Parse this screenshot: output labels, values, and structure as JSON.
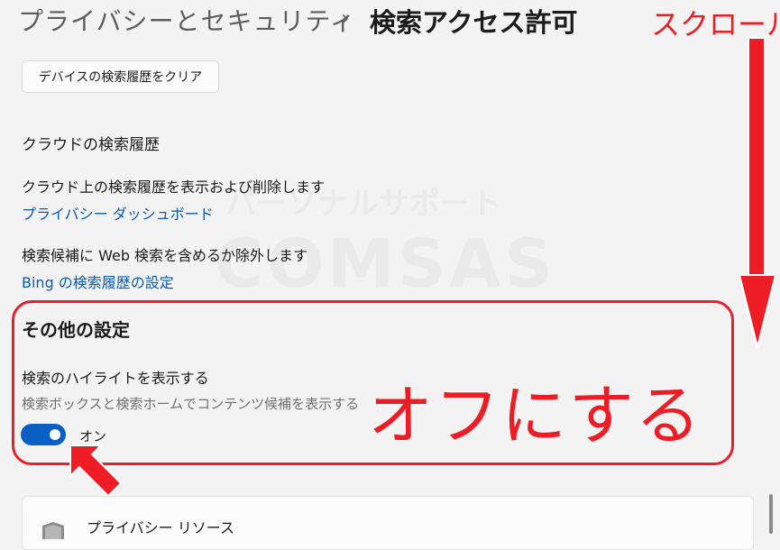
{
  "breadcrumb": {
    "parent": "プライバシーとセキュリティ",
    "separator": "›",
    "current": "検索アクセス許可"
  },
  "clear_button_label": "デバイスの検索履歴をクリア",
  "cloud_history": {
    "heading": "クラウドの検索履歴",
    "description": "クラウド上の検索履歴を表示および削除します",
    "dashboard_link": "プライバシー ダッシュボード",
    "web_description": "検索候補に Web 検索を含めるか除外します",
    "bing_link": "Bing の検索履歴の設定"
  },
  "other_settings": {
    "title": "その他の設定",
    "highlight_label": "検索のハイライトを表示する",
    "highlight_sub": "検索ボックスと検索ホームでコンテンツ候補を表示する",
    "toggle_on": true,
    "toggle_state_label": "オン"
  },
  "resources_card": {
    "title": "プライバシー リソース",
    "icon": "shield-icon"
  },
  "annotations": {
    "scroll_label": "スクロール",
    "callout_text": "オフにする",
    "color": "#ee1c25"
  },
  "watermark": {
    "line1": "パーソナルサポート",
    "line2": "COMSAS"
  },
  "colors": {
    "background": "#f3f3f3",
    "link": "#0a5ab0",
    "toggle_on": "#0a5fc4"
  }
}
